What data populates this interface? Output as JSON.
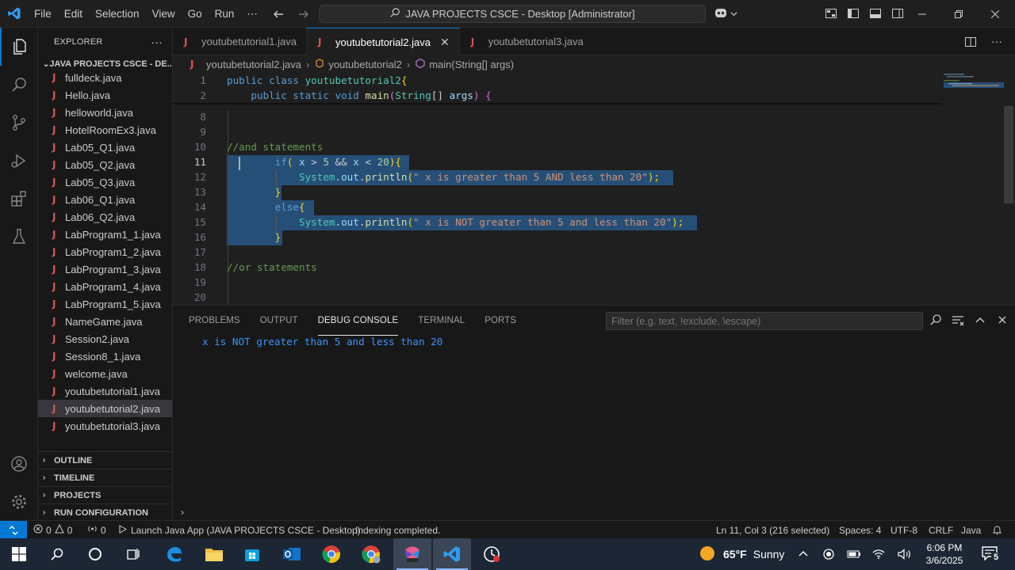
{
  "titlebar": {
    "menu": [
      "File",
      "Edit",
      "Selection",
      "View",
      "Go",
      "Run",
      "⋯"
    ],
    "search_text": "JAVA PROJECTS CSCE - Desktop [Administrator]"
  },
  "explorer": {
    "header": "EXPLORER",
    "folder": "JAVA PROJECTS CSCE - DE...",
    "files": [
      "fulldeck.java",
      "Hello.java",
      "helloworld.java",
      "HotelRoomEx3.java",
      "Lab05_Q1.java",
      "Lab05_Q2.java",
      "Lab05_Q3.java",
      "Lab06_Q1.java",
      "Lab06_Q2.java",
      "LabProgram1_1.java",
      "LabProgram1_2.java",
      "LabProgram1_3.java",
      "LabProgram1_4.java",
      "LabProgram1_5.java",
      "NameGame.java",
      "Session2.java",
      "Session8_1.java",
      "welcome.java",
      "youtubetutorial1.java",
      "youtubetutorial2.java",
      "youtubetutorial3.java"
    ],
    "selected_file": "youtubetutorial2.java",
    "sections": [
      "OUTLINE",
      "TIMELINE",
      "PROJECTS",
      "RUN CONFIGURATION"
    ]
  },
  "tabs": [
    {
      "label": "youtubetutorial1.java",
      "active": false
    },
    {
      "label": "youtubetutorial2.java",
      "active": true
    },
    {
      "label": "youtubetutorial3.java",
      "active": false
    }
  ],
  "breadcrumb": [
    "youtubetutorial2.java",
    "youtubetutorial2",
    "main(String[] args)"
  ],
  "editor": {
    "line_numbers": [
      "1",
      "2",
      "8",
      "9",
      "10",
      "11",
      "12",
      "13",
      "14",
      "15",
      "16",
      "17",
      "18",
      "19",
      "20"
    ],
    "current_line": "11",
    "lines": {
      "l1": {
        "kw": "public class ",
        "cls": "youtubetutorial2",
        "brace": "{"
      },
      "l2": {
        "kw1": "public static void ",
        "fn": "main",
        "p1": "(",
        "cls": "String",
        "p2": "[] ",
        "var": "args",
        "p3": ") ",
        "brace": "{"
      },
      "l10": "//and statements",
      "l11": {
        "kw": "if",
        "p1": "( ",
        "v1": "x",
        "op1": " > ",
        "n1": "5",
        "op2": " && ",
        "v2": "x",
        "op3": " < ",
        "n2": "20",
        "p2": "){"
      },
      "l12": {
        "cls": "System",
        "dot1": ".",
        "var": "out",
        "dot2": ".",
        "fn": "println",
        "p1": "(",
        "str": "\" x is greater than 5 AND less than 20\"",
        "p2": ");"
      },
      "l13": "}",
      "l14": {
        "kw": "else",
        "brace": "{"
      },
      "l15": {
        "cls": "System",
        "dot1": ".",
        "var": "out",
        "dot2": ".",
        "fn": "println",
        "p1": "(",
        "str": "\" x is NOT greater than 5 and less than 20\"",
        "p2": ");"
      },
      "l16": "}",
      "l18": "//or statements"
    }
  },
  "panel": {
    "tabs": [
      "PROBLEMS",
      "OUTPUT",
      "DEBUG CONSOLE",
      "TERMINAL",
      "PORTS"
    ],
    "active_tab": "DEBUG CONSOLE",
    "filter_placeholder": "Filter (e.g. text, !exclude, \\escape)",
    "output": "x is NOT greater than 5 and less than 20"
  },
  "statusbar": {
    "errors": "0",
    "warnings": "0",
    "ports": "0",
    "launch": "Launch Java App (JAVA PROJECTS CSCE - Desktop)",
    "indexing": "Indexing completed.",
    "cursor": "Ln 11, Col 3 (216 selected)",
    "spaces": "Spaces: 4",
    "encoding": "UTF-8",
    "eol": "CRLF",
    "language": "Java"
  },
  "taskbar": {
    "temperature": "65°F",
    "weather": "Sunny",
    "time": "6:06 PM",
    "date": "3/6/2025",
    "notifications": "5"
  },
  "colors": {
    "accent": "#0078d4",
    "selection": "#264f78",
    "console_text": "#3794ff"
  }
}
